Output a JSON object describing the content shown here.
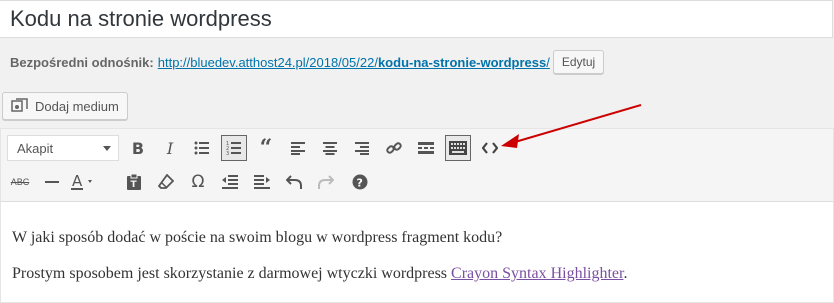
{
  "post": {
    "title": "Kodu na stronie wordpress"
  },
  "permalink": {
    "label": "Bezpośredni odnośnik:",
    "url_base": "http://bluedev.atthost24.pl/2018/05/22/",
    "url_slug": "kodu-na-stronie-wordpress",
    "url_tail": "/",
    "edit_label": "Edytuj"
  },
  "media": {
    "button_label": "Dodaj medium"
  },
  "toolbar": {
    "format_select": "Akapit",
    "row1": [
      "bold-icon",
      "italic-icon",
      "bullet-list-icon",
      "numbered-list-icon",
      "blockquote-icon",
      "align-left-icon",
      "align-center-icon",
      "align-right-icon",
      "link-icon",
      "read-more-icon",
      "toolbar-toggle-icon",
      "code-icon"
    ],
    "row2": [
      "strikethrough-icon",
      "horizontal-line-icon",
      "text-color-icon",
      "paste-text-icon",
      "clear-formatting-icon",
      "special-character-icon",
      "outdent-icon",
      "indent-icon",
      "undo-icon",
      "redo-icon",
      "help-icon"
    ]
  },
  "content": {
    "paragraph1": "W jaki sposób dodać w poście na swoim blogu w wordpress fragment kodu?",
    "paragraph2_text": "Prostym sposobem jest skorzystanie z darmowej wtyczki wordpress ",
    "paragraph2_link": "Crayon Syntax Highlighter",
    "paragraph2_end": "."
  },
  "colors": {
    "link": "#0073aa",
    "visited_link": "#7b4fa0",
    "annotation_arrow": "#cc0000"
  }
}
